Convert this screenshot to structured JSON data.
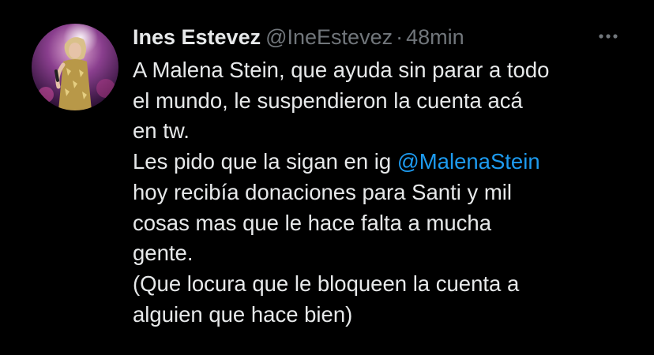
{
  "tweet": {
    "author": {
      "display_name": "Ines Estevez",
      "handle": "@IneEstevez",
      "separator": "·",
      "time": "48min",
      "avatar_icon": "avatar-photo"
    },
    "more_icon": "more-options-icon",
    "body": {
      "line1": "A Malena Stein, que ayuda sin parar a todo",
      "line2": "el mundo, le suspendieron la cuenta acá",
      "line3": "en tw.",
      "line4_prefix": "Les pido que la sigan en ig ",
      "line4_mention": "@MalenaStein",
      "line5": "hoy recibía donaciones para Santi y mil",
      "line6": "cosas mas que le hace falta a mucha",
      "line7": "gente.",
      "line8": "(Que locura que le bloqueen la cuenta a",
      "line9": "alguien que hace bien)"
    }
  },
  "colors": {
    "background": "#000000",
    "text": "#e7e9ea",
    "secondary": "#71767b",
    "link": "#1d9bf0"
  }
}
